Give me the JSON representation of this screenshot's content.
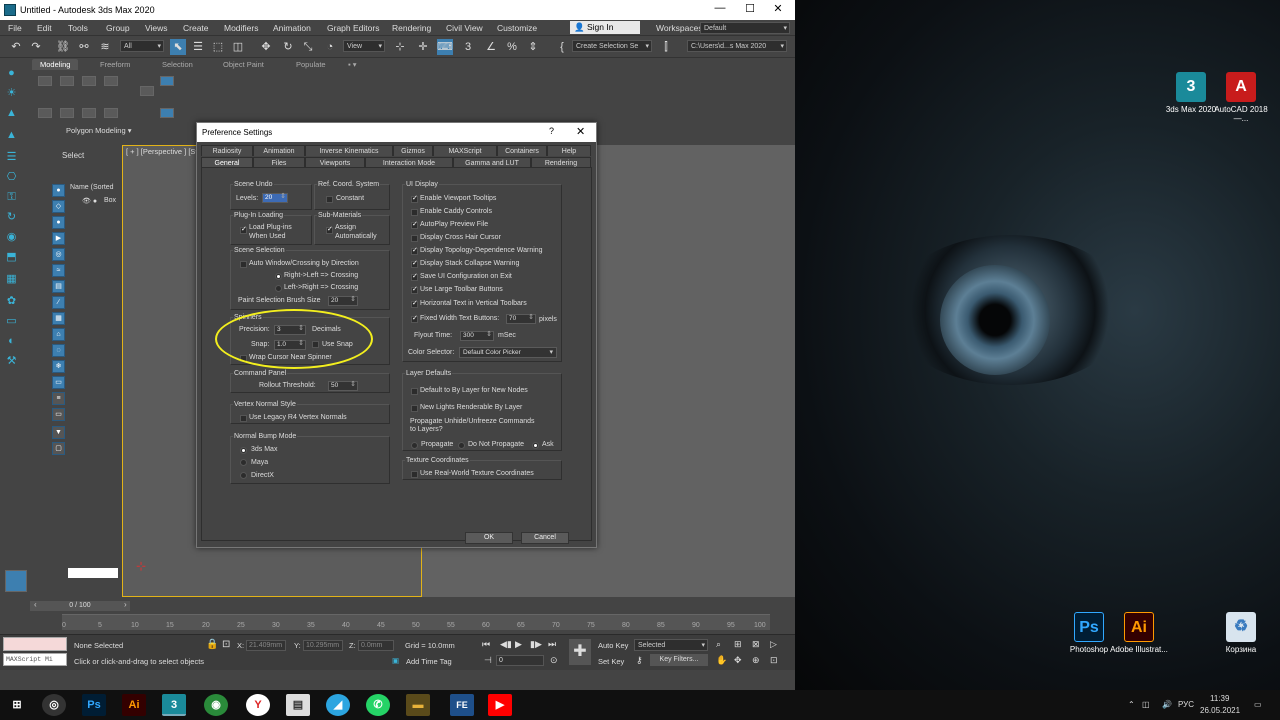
{
  "window": {
    "title": "Untitled - Autodesk 3ds Max 2020",
    "controls": [
      "—",
      "☐",
      "✕"
    ]
  },
  "menubar": {
    "items": [
      "File",
      "Edit",
      "Tools",
      "Group",
      "Views",
      "Create",
      "Modifiers",
      "Animation",
      "Graph Editors",
      "Rendering",
      "Civil View",
      "Customize"
    ],
    "sign_in": "Sign In",
    "workspaces_label": "Workspaces:",
    "workspace_value": "Default"
  },
  "toolbar": {
    "filter_value": "All",
    "view_value": "View",
    "selection_set": "Create Selection Se",
    "project_path": "C:\\Users\\d...s Max 2020"
  },
  "ribbon": {
    "tabs": [
      "Modeling",
      "Freeform",
      "Selection",
      "Object Paint",
      "Populate"
    ],
    "panel_label": "Polygon Modeling"
  },
  "scene": {
    "select_label": "Select",
    "name_header": "Name (Sorted",
    "object": "Box"
  },
  "viewport": {
    "label": "[ + ] [Perspective ] [St"
  },
  "timeline": {
    "frame_counter": "0 / 100",
    "ticks": [
      "0",
      "5",
      "10",
      "15",
      "20",
      "25",
      "30",
      "35",
      "40",
      "45",
      "50",
      "55",
      "60",
      "65",
      "70",
      "75",
      "80",
      "85",
      "90",
      "95",
      "100"
    ]
  },
  "status": {
    "selection": "None Selected",
    "prompt": "Click or click-and-drag to select objects",
    "maxscript": "MAXScript Mi",
    "x_label": "X:",
    "x_value": "21.409mm",
    "y_label": "Y:",
    "y_value": "10.295mm",
    "z_label": "Z:",
    "z_value": "0.0mm",
    "grid": "Grid = 10.0mm",
    "add_time_tag": "Add Time Tag",
    "auto_key": "Auto Key",
    "set_key": "Set Key",
    "selected_value": "Selected",
    "key_filters": "Key Filters...",
    "current_frame": "0"
  },
  "dialog": {
    "title": "Preference Settings",
    "help": "?",
    "close": "✕",
    "tabs_row1": [
      "Radiosity",
      "Animation",
      "Inverse Kinematics",
      "Gizmos",
      "MAXScript",
      "Containers",
      "Help"
    ],
    "tabs_row2": [
      "General",
      "Files",
      "Viewports",
      "Interaction Mode",
      "Gamma and LUT",
      "Rendering"
    ],
    "scene_undo": {
      "title": "Scene Undo",
      "levels_label": "Levels:",
      "levels_value": "20"
    },
    "ref_coord": {
      "title": "Ref. Coord. System",
      "constant": "Constant"
    },
    "plugin_loading": {
      "title": "Plug-In Loading",
      "load_line1": "Load Plug-ins",
      "load_line2": "When Used"
    },
    "sub_materials": {
      "title": "Sub-Materials",
      "assign_line1": "Assign",
      "assign_line2": "Automatically"
    },
    "scene_selection": {
      "title": "Scene Selection",
      "auto_window": "Auto Window/Crossing by Direction",
      "right_left": "Right->Left => Crossing",
      "left_right": "Left->Right => Crossing",
      "paint_brush_label": "Paint Selection Brush Size",
      "paint_brush_value": "20"
    },
    "spinners": {
      "title": "Spinners",
      "precision_label": "Precision:",
      "precision_value": "3",
      "decimals": "Decimals",
      "snap_label": "Snap:",
      "snap_value": "1.0",
      "use_snap": "Use Snap",
      "wrap_cursor": "Wrap Cursor Near Spinner"
    },
    "command_panel": {
      "title": "Command Panel",
      "rollout_label": "Rollout Threshold:",
      "rollout_value": "50"
    },
    "vertex_normal": {
      "title": "Vertex Normal Style",
      "legacy": "Use Legacy R4 Vertex Normals"
    },
    "normal_bump": {
      "title": "Normal Bump Mode",
      "options": [
        "3ds Max",
        "Maya",
        "DirectX"
      ]
    },
    "ui_display": {
      "title": "UI Display",
      "options": [
        {
          "label": "Enable Viewport Tooltips",
          "checked": true
        },
        {
          "label": "Enable Caddy Controls",
          "checked": false
        },
        {
          "label": "AutoPlay Preview File",
          "checked": true
        },
        {
          "label": "Display Cross Hair Cursor",
          "checked": false
        },
        {
          "label": "Display Topology-Dependence Warning",
          "checked": true
        },
        {
          "label": "Display Stack Collapse Warning",
          "checked": true
        },
        {
          "label": "Save UI Configuration on Exit",
          "checked": true
        },
        {
          "label": "Use Large Toolbar Buttons",
          "checked": true
        },
        {
          "label": "Horizontal Text in Vertical Toolbars",
          "checked": true
        }
      ],
      "fixed_width_label": "Fixed Width Text Buttons:",
      "fixed_width_value": "70",
      "pixels": "pixels",
      "flyout_label": "Flyout Time:",
      "flyout_value": "300",
      "msec": "mSec",
      "color_selector_label": "Color Selector:",
      "color_selector_value": "Default Color Picker"
    },
    "layer_defaults": {
      "title": "Layer Defaults",
      "default_bylayer": "Default to By Layer for New Nodes",
      "new_lights": "New Lights Renderable By Layer",
      "propagate_line1": "Propagate Unhide/Unfreeze Commands",
      "propagate_line2": "to Layers?",
      "propagate": "Propagate",
      "do_not": "Do Not Propagate",
      "ask": "Ask"
    },
    "texture_coords": {
      "title": "Texture Coordinates",
      "real_world": "Use Real-World Texture Coordinates"
    },
    "ok": "OK",
    "cancel": "Cancel"
  },
  "desktop": {
    "icons": [
      {
        "glyph": "3",
        "label": "3ds Max 2020"
      },
      {
        "glyph": "A",
        "label": "AutoCAD 2018 —..."
      },
      {
        "glyph": "Ps",
        "label": "Photoshop"
      },
      {
        "glyph": "Ai",
        "label": "Adobe Illustrat..."
      },
      {
        "glyph": "♻",
        "label": "Корзина"
      }
    ]
  },
  "taskbar": {
    "apps": [
      "⊞",
      "◎",
      "Ps",
      "Ai",
      "3",
      "◉",
      "Y",
      "▤",
      "◢",
      "✆",
      "▬",
      "FE",
      "▶"
    ],
    "lang": "РУС",
    "time": "11:39",
    "date": "26.05.2021"
  },
  "colors": {
    "accent_blue": "#3ab4d8",
    "highlight_yellow": "#f3ef1e",
    "viewport_border": "#e2b318"
  }
}
